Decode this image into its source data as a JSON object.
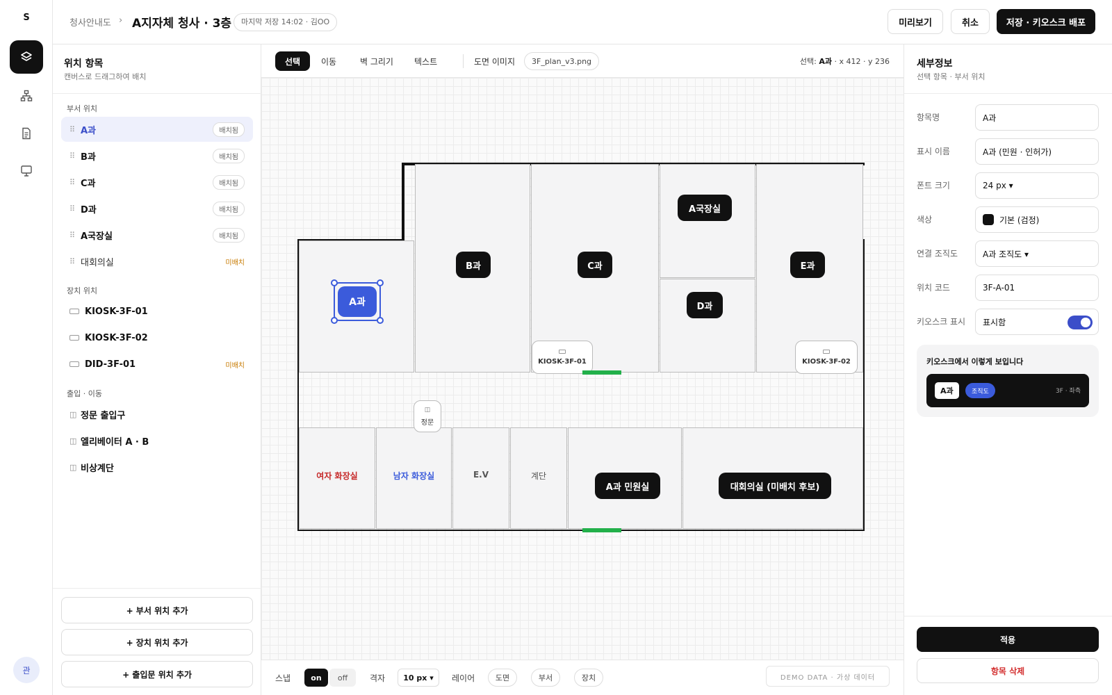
{
  "rail": {
    "logo": "S",
    "items": [
      {
        "name": "layers-icon",
        "active": true
      },
      {
        "name": "org-chart-icon",
        "active": false
      },
      {
        "name": "document-icon",
        "active": false
      },
      {
        "name": "kiosk-monitor-icon",
        "active": false
      }
    ],
    "avatar": "관"
  },
  "header": {
    "breadcrumb": "청사안내도",
    "separator": "›",
    "title": "A지자체 청사 · 3층",
    "save_status": "마지막 저장 14:02 · 김OO",
    "preview_label": "미리보기",
    "cancel_label": "취소",
    "deploy_label": "저장 · 키오스크 배포"
  },
  "left_panel": {
    "title": "위치 항목",
    "subtitle": "캔버스로 드래그하여 배치",
    "sections": {
      "dept": "부서 위치",
      "device": "장치 위치",
      "access": "출입 · 이동"
    },
    "dept_items": [
      {
        "label": "A과",
        "status": "배치됨"
      },
      {
        "label": "B과",
        "status": "배치됨"
      },
      {
        "label": "C과",
        "status": "배치됨"
      },
      {
        "label": "D과",
        "status": "배치됨"
      },
      {
        "label": "A국장실",
        "status": "배치됨"
      },
      {
        "label": "대회의실",
        "status": "미배치"
      }
    ],
    "device_items": [
      {
        "label": "KIOSK-3F-01",
        "status": ""
      },
      {
        "label": "KIOSK-3F-02",
        "status": ""
      },
      {
        "label": "DID-3F-01",
        "status": "미배치"
      }
    ],
    "access_items": [
      {
        "label": "정문 출입구"
      },
      {
        "label": "엘리베이터 A · B"
      },
      {
        "label": "비상계단"
      }
    ],
    "add_dept": "+ 부서 위치 추가",
    "add_device": "+ 장치 위치 추가",
    "add_access": "+ 출입문 위치 추가"
  },
  "toolbar": {
    "tools": [
      "선택",
      "이동",
      "벽 그리기",
      "텍스트"
    ],
    "active_tool": "선택",
    "plan_label": "도면 이미지",
    "plan_file": "3F_plan_v3.png",
    "selection_prefix": "선택:",
    "selection_name": "A과",
    "selection_coords": "· x 412 · y 236"
  },
  "floorplan": {
    "rooms": {
      "a": "A과",
      "b": "B과",
      "c": "C과",
      "a_director": "A국장실",
      "d": "D과",
      "e": "E과",
      "women_restroom": "여자 화장실",
      "men_restroom": "남자 화장실",
      "ev": "E.V",
      "stairs": "계단",
      "a_civil": "A과 민원실",
      "conference": "대회의실 (미배치 후보)"
    },
    "kiosk1": "KIOSK-3F-01",
    "kiosk2": "KIOSK-3F-02",
    "main_door": "정문"
  },
  "bottom_bar": {
    "snap_label": "스냅",
    "snap_on": "on",
    "snap_off": "off",
    "grid_label": "격자",
    "grid_value": "10 px ▾",
    "layer_label": "레이어",
    "layers": [
      "도면",
      "부서",
      "장치"
    ],
    "demo_note": "DEMO DATA · 가상 데이터"
  },
  "right_panel": {
    "title": "세부정보",
    "subtitle": "선택 항목 · 부서 위치",
    "fields": {
      "name_label": "항목명",
      "name_value": "A과",
      "display_label": "표시 이름",
      "display_value": "A과 (민원 · 인허가)",
      "font_label": "폰트 크기",
      "font_value": "24 px ▾",
      "color_label": "색상",
      "color_value": "기본 (검정)",
      "org_label": "연결 조직도",
      "org_value": "A과 조직도 ▾",
      "code_label": "위치 코드",
      "code_value": "3F-A-01",
      "kiosk_label": "키오스크 표시",
      "kiosk_value": "표시함",
      "kiosk_enabled": true
    },
    "preview_title": "키오스크에서 이렇게 보입니다",
    "preview_name": "A과",
    "preview_org": "조직도",
    "preview_loc": "3F · 좌측",
    "apply_label": "적용",
    "delete_label": "항목 삭제"
  },
  "colors": {
    "accent": "#3b4ec9",
    "selected_room": "#3b5bdb",
    "door_green": "#22b04a",
    "unplaced": "#c77a00",
    "women": "#c62828",
    "men": "#3b5bdb",
    "delete": "#d32f2f"
  }
}
